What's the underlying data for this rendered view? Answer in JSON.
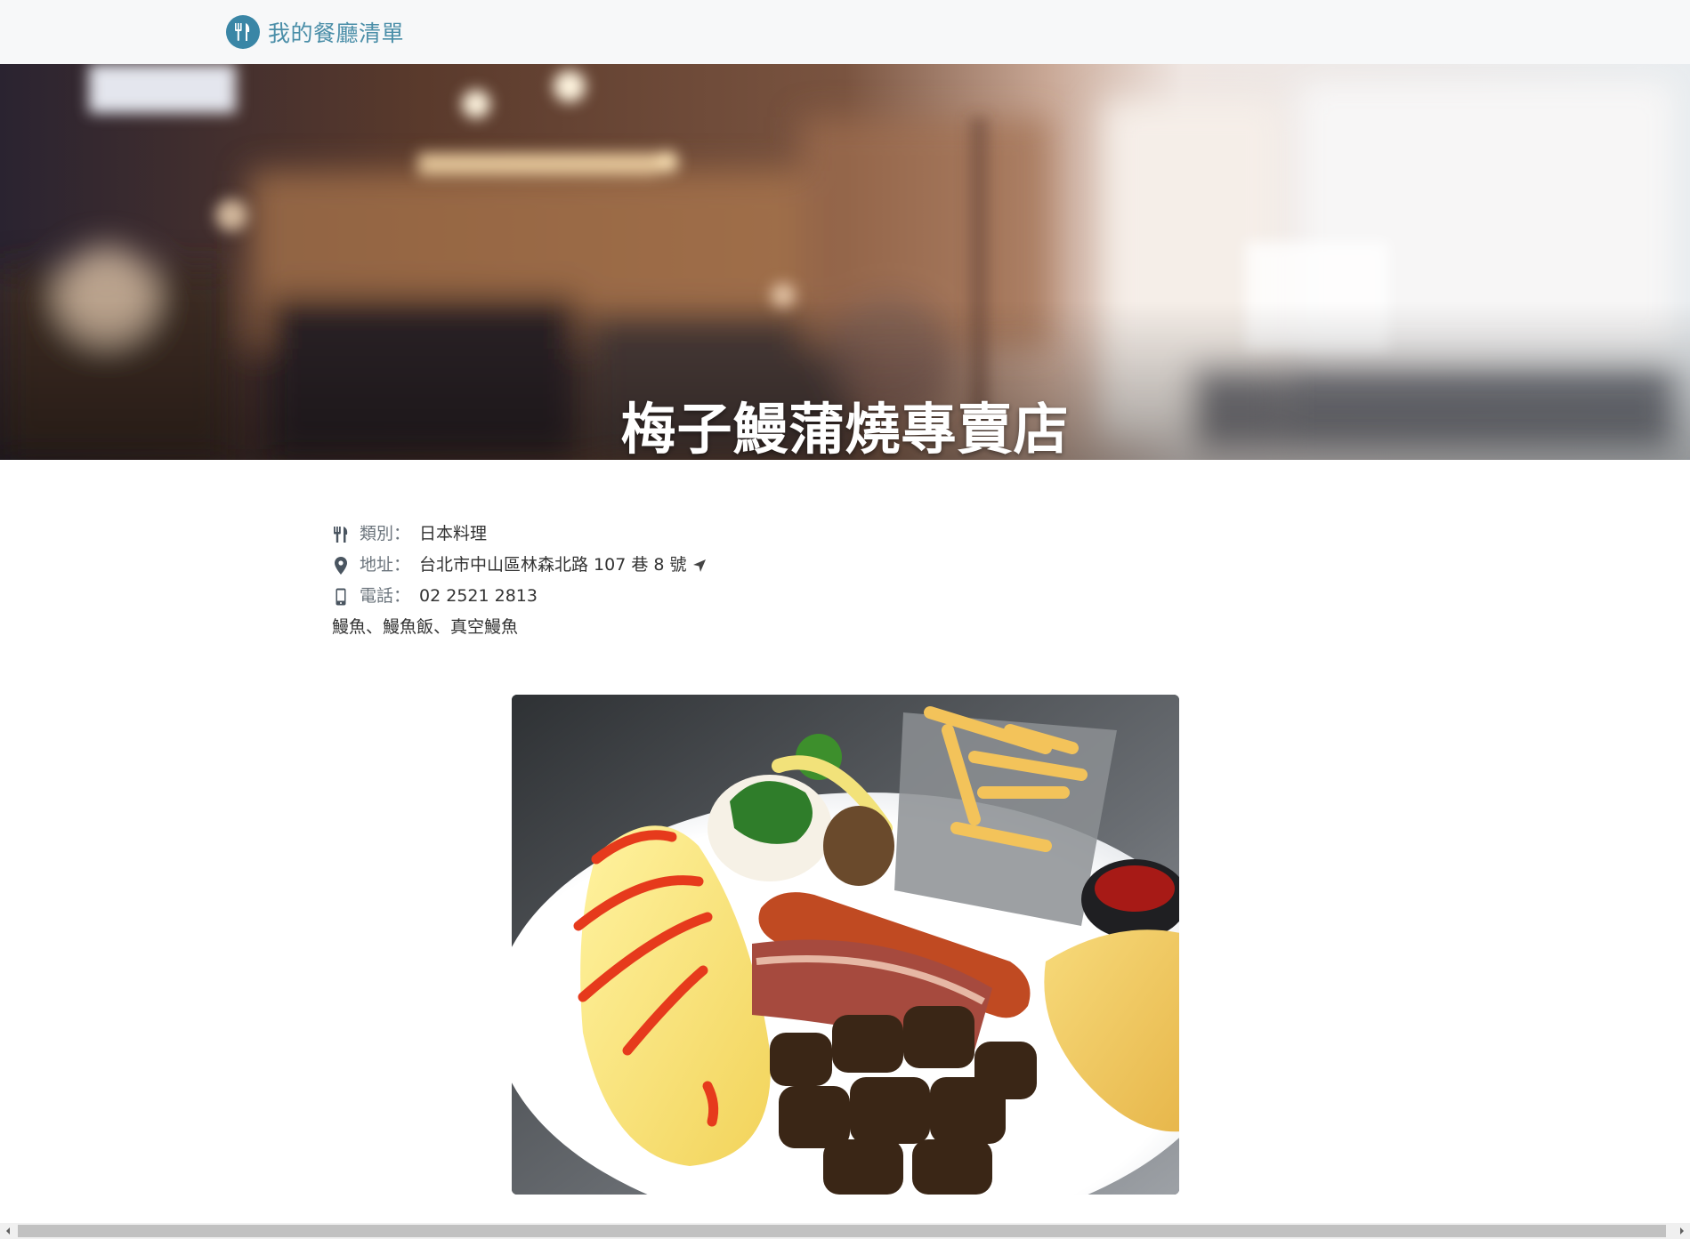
{
  "navbar": {
    "brand_icon": "utensils-icon",
    "brand_text": "我的餐廳清單"
  },
  "banner": {
    "title": "梅子鰻蒲燒專賣店"
  },
  "info": {
    "category": {
      "icon": "utensils-icon",
      "label": "類別：",
      "value": "日本料理"
    },
    "address": {
      "icon": "map-marker-icon",
      "label": "地址：",
      "value": "台北市中山區林森北路 107 巷 8 號",
      "action_icon": "location-arrow-icon"
    },
    "phone": {
      "icon": "mobile-phone-icon",
      "label": "電話：",
      "value": "02 2521 2813"
    },
    "description": "鰻魚、鰻魚飯、真空鰻魚"
  },
  "colors": {
    "brand": "#4a8ea8",
    "navbar_bg": "#f7f8f9",
    "label": "#6c757d"
  }
}
